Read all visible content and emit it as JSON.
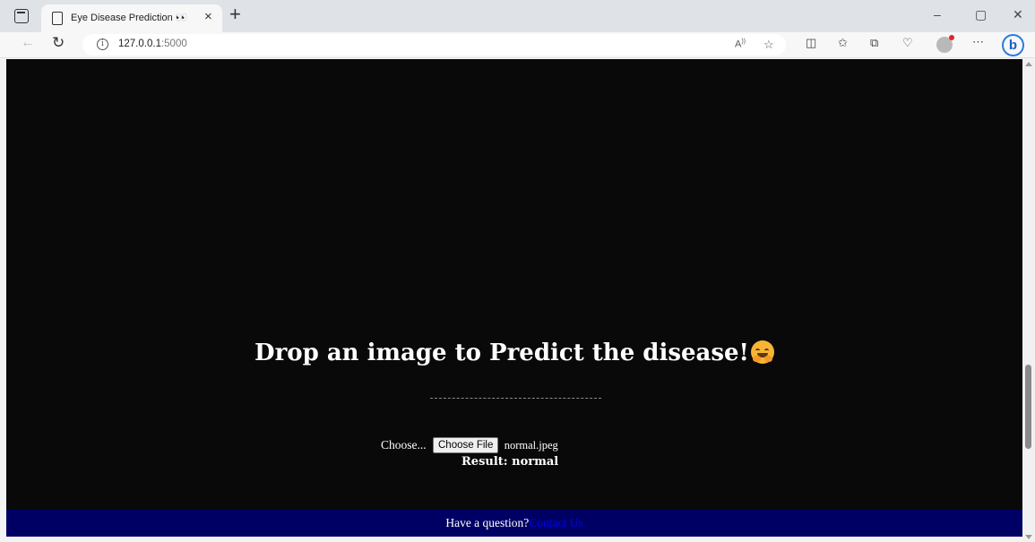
{
  "browser": {
    "tab_title": "Eye Disease Prediction 👀",
    "url_host": "127.0.0.1",
    "url_port": ":5000",
    "new_tab_glyph": "+",
    "tab_close_glyph": "×",
    "minimize_glyph": "–",
    "restore_glyph": "▢",
    "close_glyph": "✕",
    "icons": [
      "tab-actions-icon",
      "page-icon",
      "back-icon",
      "reload-icon",
      "info-icon",
      "read-aloud-icon",
      "favorite-star-icon",
      "split-screen-icon",
      "favorites-icon",
      "collections-icon",
      "browser-essentials-icon",
      "profile-avatar",
      "more-icon",
      "bing-copilot-icon"
    ]
  },
  "page": {
    "headline": "Drop an image to Predict the disease!",
    "file_label": "Choose...",
    "file_button": "Choose File",
    "file_name": "normal.jpeg",
    "result": "Result: normal",
    "footer_text": "Have a question?",
    "footer_link": "Contact Us",
    "colors": {
      "background": "#090909",
      "footer": "#000064",
      "link": "#0000ee",
      "text": "#ffffff"
    }
  }
}
